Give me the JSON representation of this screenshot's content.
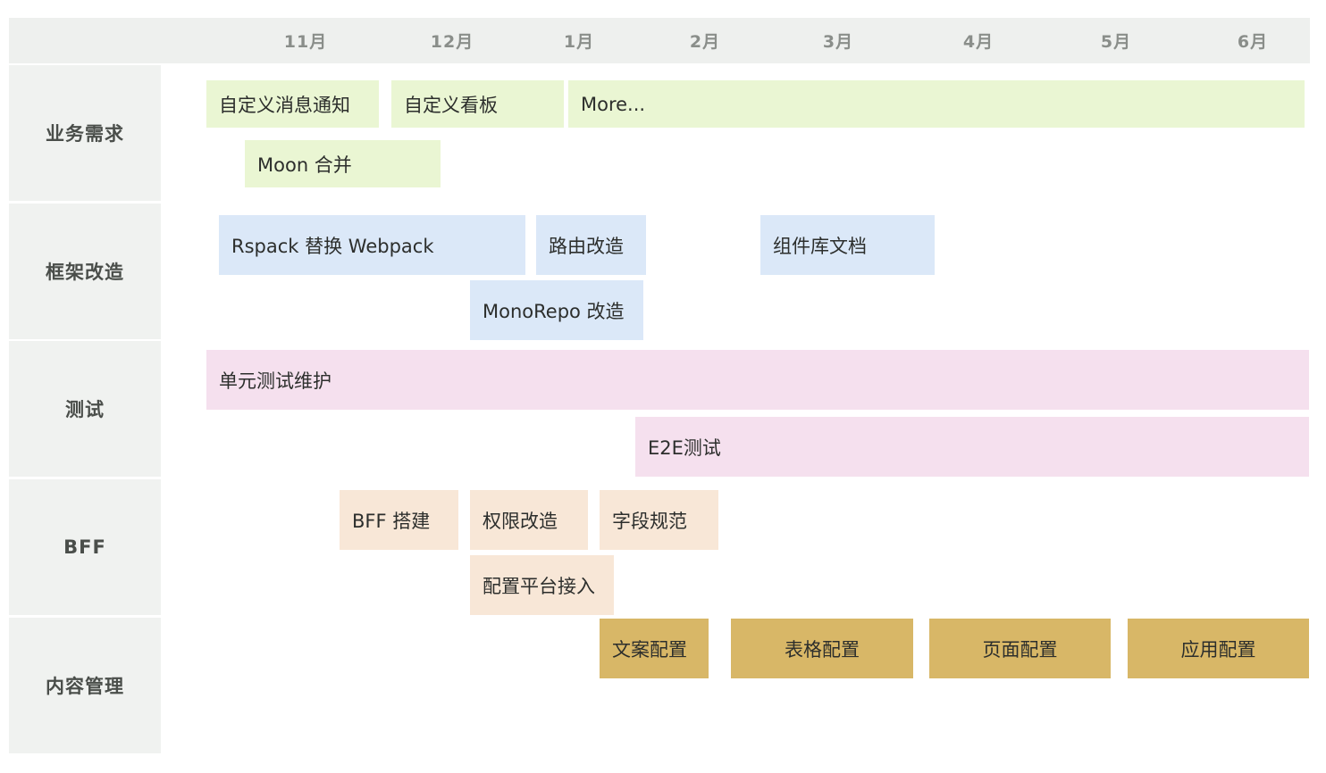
{
  "colors": {
    "business": "#eaf6d3",
    "framework": "#dbe8f8",
    "testing": "#f5e0ee",
    "bff": "#f8e7d7",
    "content": "#d8b767"
  },
  "timeline": {
    "months": [
      "11月",
      "12月",
      "1月",
      "2月",
      "3月",
      "4月",
      "5月",
      "6月"
    ],
    "lanes": [
      {
        "label": "业务需求",
        "color_key": "business",
        "tasks": [
          {
            "label": "自定义消息通知"
          },
          {
            "label": "自定义看板"
          },
          {
            "label": "More..."
          },
          {
            "label": "Moon 合并"
          }
        ]
      },
      {
        "label": "框架改造",
        "color_key": "framework",
        "tasks": [
          {
            "label": "Rspack 替换 Webpack"
          },
          {
            "label": "路由改造"
          },
          {
            "label": "组件库文档"
          },
          {
            "label": "MonoRepo 改造"
          }
        ]
      },
      {
        "label": "测试",
        "color_key": "testing",
        "tasks": [
          {
            "label": "单元测试维护"
          },
          {
            "label": "E2E测试"
          }
        ]
      },
      {
        "label": "BFF",
        "color_key": "bff",
        "tasks": [
          {
            "label": "BFF 搭建"
          },
          {
            "label": "权限改造"
          },
          {
            "label": "字段规范"
          },
          {
            "label": "配置平台接入"
          }
        ]
      },
      {
        "label": "内容管理",
        "color_key": "content",
        "tasks": [
          {
            "label": "文案配置"
          },
          {
            "label": "表格配置"
          },
          {
            "label": "页面配置"
          },
          {
            "label": "应用配置"
          }
        ]
      }
    ]
  }
}
